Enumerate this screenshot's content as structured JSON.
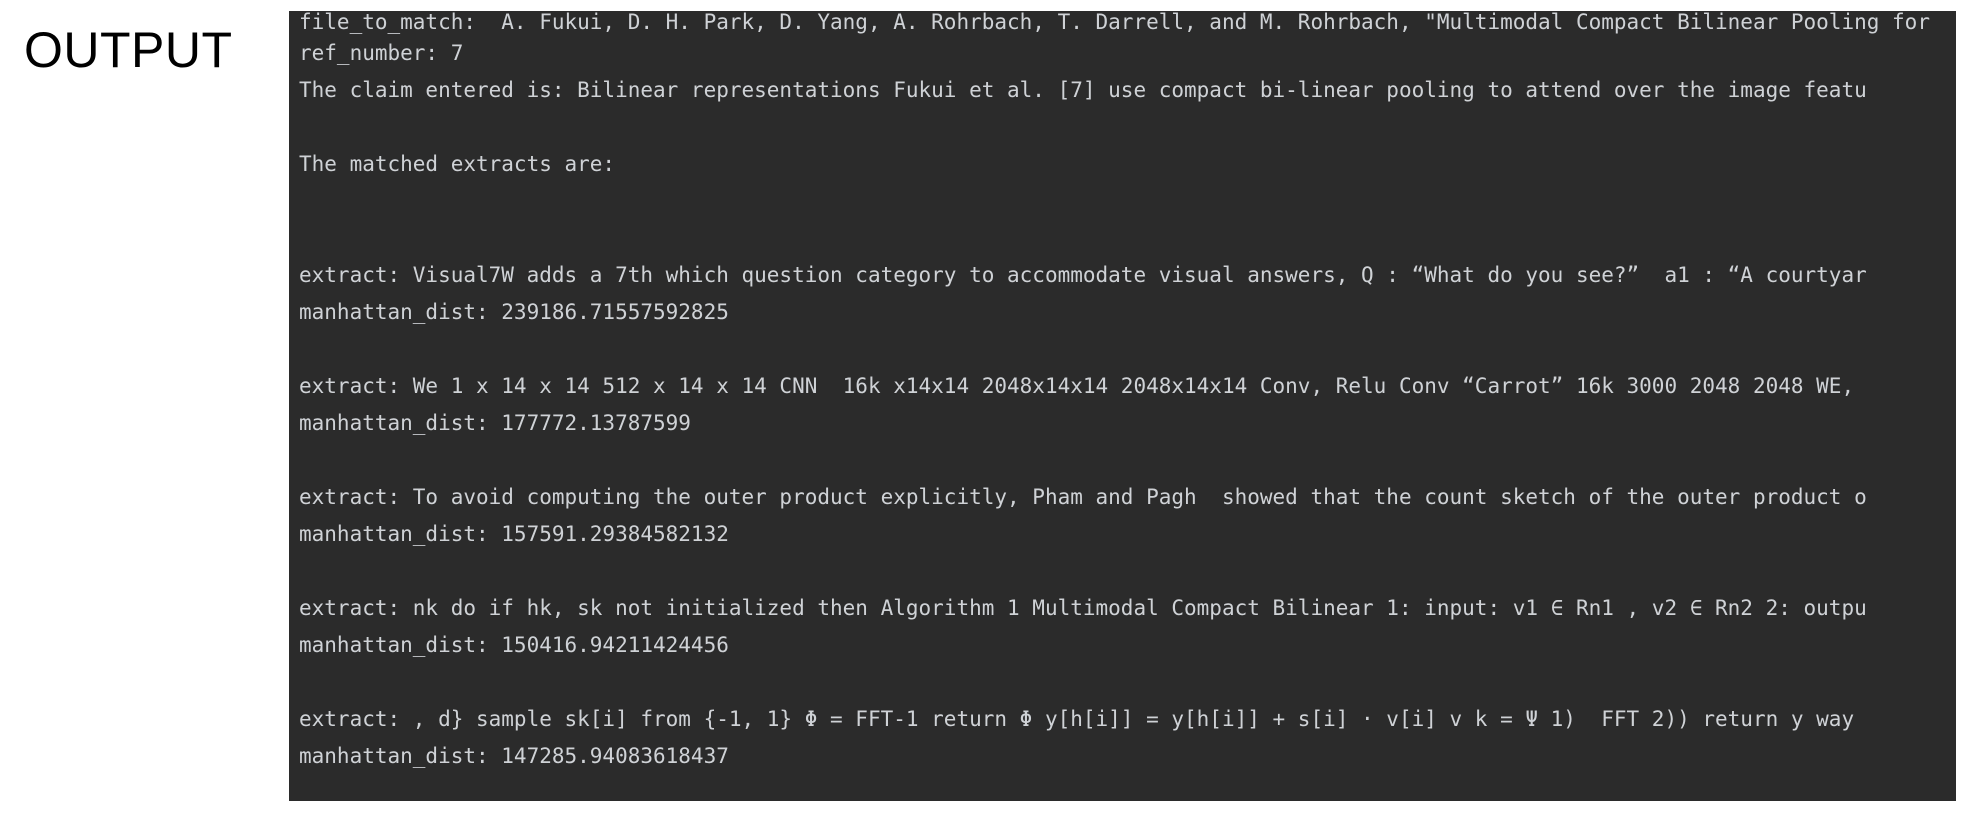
{
  "heading": "OUTPUT",
  "console": {
    "file_to_match": "file_to_match:  A. Fukui, D. H. Park, D. Yang, A. Rohrbach, T. Darrell, and M. Rohrbach, \"Multimodal Compact Bilinear Pooling for",
    "ref_number": "ref_number: 7",
    "claim": "The claim entered is: Bilinear representations Fukui et al. [7] use compact bi-linear pooling to attend over the image featu",
    "matched_header": "The matched extracts are:",
    "results": [
      {
        "extract": "extract: Visual7W adds a 7th which question category to accommodate visual answers, Q : “What do you see?”  a1 : “A courtyar",
        "dist": "manhattan_dist: 239186.71557592825"
      },
      {
        "extract": "extract: We 1 x 14 x 14 512 x 14 x 14 CNN  16k x14x14 2048x14x14 2048x14x14 Conv, Relu Conv “Carrot” 16k 3000 2048 2048 WE,",
        "dist": "manhattan_dist: 177772.13787599"
      },
      {
        "extract": "extract: To avoid computing the outer product explicitly, Pham and Pagh  showed that the count sketch of the outer product o",
        "dist": "manhattan_dist: 157591.29384582132"
      },
      {
        "extract": "extract: nk do if hk, sk not initialized then Algorithm 1 Multimodal Compact Bilinear 1: input: v1 ∈ Rn1 , v2 ∈ Rn2 2: outpu",
        "dist": "manhattan_dist: 150416.94211424456"
      },
      {
        "extract": "extract: , d} sample sk[i] from {-1, 1} Φ = FFT-1 return Φ y[h[i]] = y[h[i]] + s[i] · v[i] v k = Ψ 1)  FFT 2)) return y way",
        "dist": "manhattan_dist: 147285.94083618437"
      }
    ]
  }
}
